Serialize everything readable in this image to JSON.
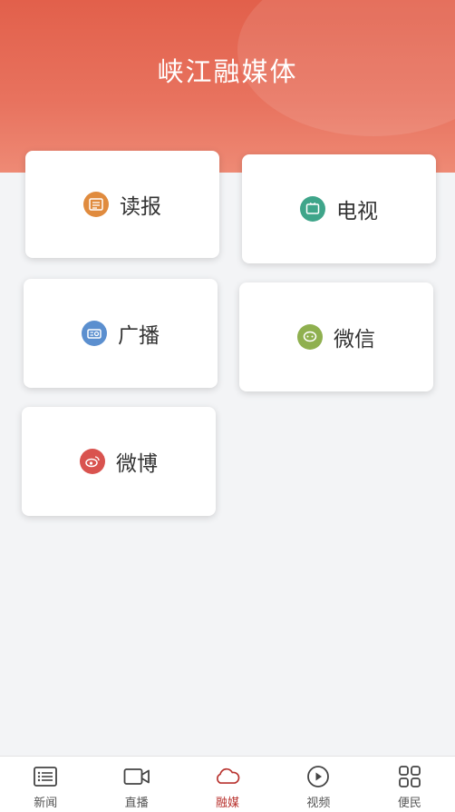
{
  "header": {
    "title": "峡江融媒体"
  },
  "colors": {
    "header_primary": "#e2604b",
    "active_tab": "#b8322e",
    "read_icon": "#e08b3e",
    "tv_icon": "#3fa58a",
    "radio_icon": "#5b8fcf",
    "wechat_icon": "#8fb04f",
    "weibo_icon": "#d9534f"
  },
  "cards": [
    {
      "label": "读报",
      "icon": "newspaper-icon"
    },
    {
      "label": "电视",
      "icon": "tv-icon"
    },
    {
      "label": "广播",
      "icon": "radio-icon"
    },
    {
      "label": "微信",
      "icon": "wechat-icon"
    },
    {
      "label": "微博",
      "icon": "weibo-icon"
    }
  ],
  "tabs": [
    {
      "label": "新闻",
      "icon": "list-icon",
      "active": false
    },
    {
      "label": "直播",
      "icon": "video-camera-icon",
      "active": false
    },
    {
      "label": "融媒",
      "icon": "cloud-icon",
      "active": true
    },
    {
      "label": "视频",
      "icon": "play-circle-icon",
      "active": false
    },
    {
      "label": "便民",
      "icon": "grid-icon",
      "active": false
    }
  ]
}
